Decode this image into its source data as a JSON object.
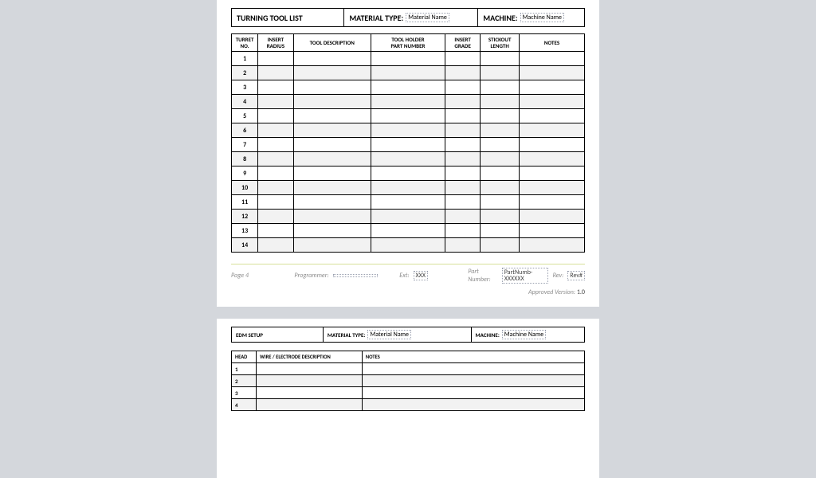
{
  "page1": {
    "header": {
      "title": "TURNING  TOOL  LIST",
      "material_label": "MATERIAL TYPE:",
      "material_value": "Material Name",
      "machine_label": "MACHINE:",
      "machine_value": "Machine Name"
    },
    "columns": {
      "c1a": "TURRET",
      "c1b": "NO.",
      "c2a": "INSERT",
      "c2b": "RADIUS",
      "c3": "TOOL DESCRIPTION",
      "c4a": "TOOL HOLDER",
      "c4b": "PART NUMBER",
      "c5a": "INSERT",
      "c5b": "GRADE",
      "c6a": "STICKOUT",
      "c6b": "LENGTH",
      "c7": "NOTES"
    },
    "rows": [
      "1",
      "2",
      "3",
      "4",
      "5",
      "6",
      "7",
      "8",
      "9",
      "10",
      "11",
      "12",
      "13",
      "14"
    ],
    "footer": {
      "page_label": "Page",
      "page_num": "4",
      "programmer_label": "Programmer:",
      "programmer_value": "",
      "ext_label": "Ext:",
      "ext_value": "XXX",
      "partnum_label": "Part Number:",
      "partnum_value": "PartNumb-XXXXXX",
      "rev_label": "Rev:",
      "rev_value": "Rev#",
      "approved_label": "Approved Version:",
      "approved_value": "1.0"
    }
  },
  "page2": {
    "header": {
      "title": "EDM SETUP",
      "material_label": "MATERIAL TYPE:",
      "material_value": "Material Name",
      "machine_label": "MACHINE:",
      "machine_value": "Machine Name"
    },
    "columns": {
      "c1": "HEAD",
      "c2": "WIRE / ELECTRODE DESCRIPTION",
      "c3": "NOTES"
    },
    "rows": [
      "1",
      "2",
      "3",
      "4"
    ]
  }
}
